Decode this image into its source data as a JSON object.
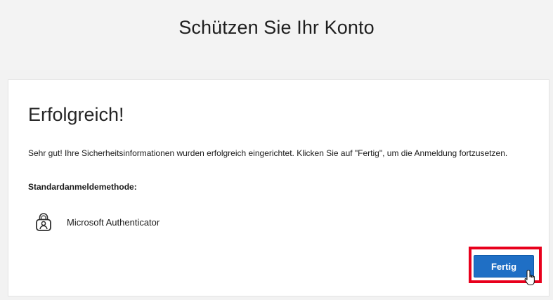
{
  "header": {
    "title": "Schützen Sie Ihr Konto"
  },
  "card": {
    "heading": "Erfolgreich!",
    "message": "Sehr gut! Ihre Sicherheitsinformationen wurden erfolgreich eingerichtet. Klicken Sie auf \"Fertig\", um die Anmeldung fortzusetzen.",
    "default_method_label": "Standardanmeldemethode:",
    "method": {
      "icon": "authenticator-lock-icon",
      "name": "Microsoft Authenticator"
    },
    "done_button_label": "Fertig"
  },
  "colors": {
    "header_background": "#f3f3f3",
    "button_background": "#1f6fc5",
    "highlight_border": "#e8001c"
  },
  "cursor": {
    "icon": "hand-pointer-icon"
  }
}
